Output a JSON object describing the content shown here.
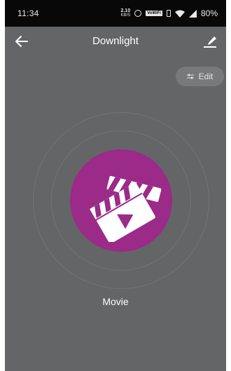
{
  "status_bar": {
    "time": "11:34",
    "speed_value": "2.10",
    "speed_unit": "KB/S",
    "network_label": "VoWiFi",
    "battery": "80%"
  },
  "app_bar": {
    "title": "Downlight",
    "back_icon": "arrow-left-icon",
    "edit_name_icon": "pen-icon"
  },
  "edit_button": {
    "label": "Edit",
    "icon": "sliders-icon"
  },
  "scene": {
    "label": "Movie",
    "icon": "clapperboard-icon",
    "color": "#9b2a89"
  },
  "colors": {
    "background": "#646566",
    "status_bar": "#080808",
    "button": "#77797a"
  }
}
